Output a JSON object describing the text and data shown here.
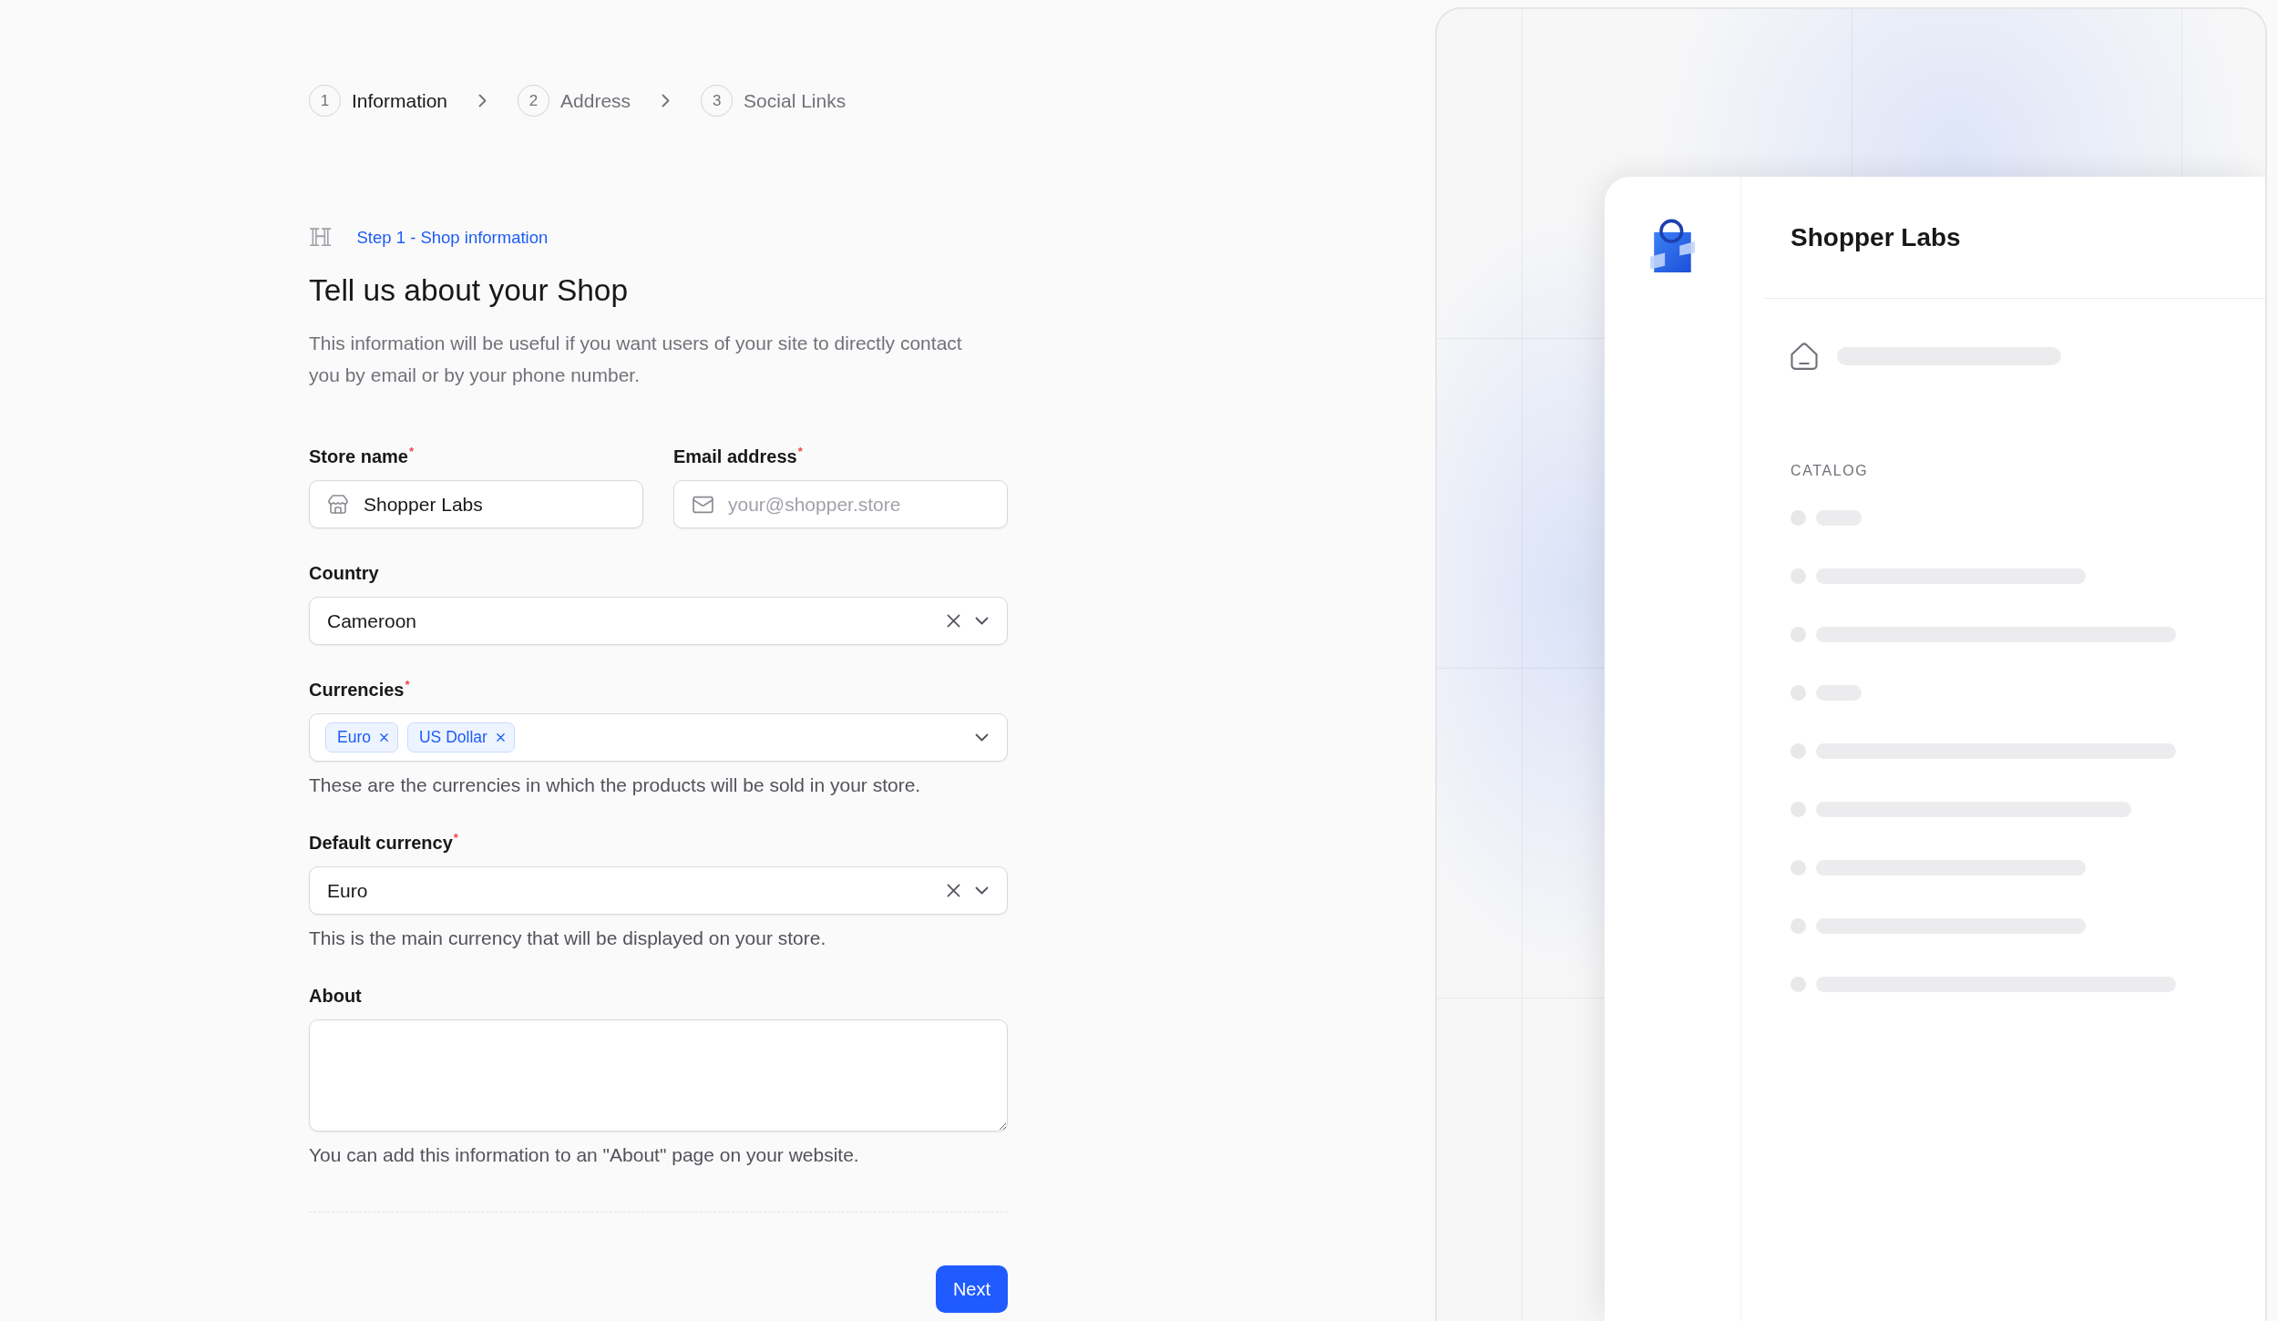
{
  "stepper": {
    "steps": [
      {
        "number": "1",
        "label": "Information",
        "selected": true
      },
      {
        "number": "2",
        "label": "Address",
        "selected": false
      },
      {
        "number": "3",
        "label": "Social Links",
        "selected": false
      }
    ]
  },
  "form": {
    "glyph": "ℍ",
    "eyebrow": "Step 1 - Shop information",
    "title": "Tell us about your Shop",
    "description": "This information will be useful if you want users of your site to directly contact you by email or by your phone number.",
    "rows": [
      {
        "fields": [
          {
            "kind": "text",
            "label": "Store name$^{*}$",
            "value": "Shopper Labs"
          },
          {
            "kind": "email",
            "label": "Email address$^{*}$",
            "placeholder": "your@shopper.store"
          }
        ]
      },
      {
        "fields": [
          {
            "kind": "select",
            "label": "Country",
            "value": "Cameroon"
          }
        ]
      },
      {
        "fields": [
          {
            "kind": "multiselect",
            "label": "Currencies$^{*}$",
            "chips": [
              "Euro",
              "US Dollar"
            ],
            "help": "These are the currencies in which the products will be sold in your store."
          }
        ]
      },
      {
        "fields": [
          {
            "kind": "select",
            "label": "Default currency$^{*}$",
            "value": "Euro",
            "help": "This is the main currency that will be displayed on your store."
          }
        ]
      },
      {
        "fields": [
          {
            "kind": "textarea",
            "label": "About",
            "help": "You can add this information to an \"About\" page on your website."
          }
        ]
      }
    ],
    "buttons": [
      "Next"
    ]
  },
  "preview": {
    "shop_name": "Shopper Labs",
    "section_label": "CATALOG"
  }
}
